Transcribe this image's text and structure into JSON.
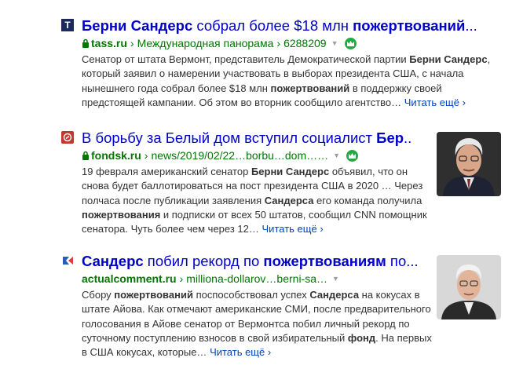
{
  "results": [
    {
      "title_bold1": "Берни Сандерс",
      "title_plain": " собрал более $18 млн ",
      "title_bold2": "пожертвований",
      "title_tail": "...",
      "domain": "tass.ru",
      "path1": "Международная панорама",
      "path2": "6288209",
      "favicon_text": "T",
      "snippet_1": "Сенатор от штата Вермонт, представитель Демократической партии ",
      "snippet_b1": "Берни Сандерс",
      "snippet_2": ", который заявил о намерении участвовать в выборах президента США, с начала нынешнего года собрал более $18 млн ",
      "snippet_b2": "пожертвований",
      "snippet_3": " в поддержку своей предстоящей кампании. Об этом во вторник сообщило агентство…",
      "more": "Читать ещё"
    },
    {
      "title_plain": "В борьбу за Белый дом вступил социалист ",
      "title_bold1": "Бер",
      "title_tail": "...",
      "domain": "fondsk.ru",
      "path1": "news/2019/02/22…borbu…dom……",
      "snippet_1": "19 февраля американский сенатор ",
      "snippet_b1": "Берни Сандерс",
      "snippet_2": " объявил, что он снова будет баллотироваться на пост президента США в 2020 … Через полчаса после публикации заявления ",
      "snippet_b2": "Сандерса",
      "snippet_3": " его команда получила ",
      "snippet_b3": "пожертвования",
      "snippet_4": " и подписки от всех 50 штатов, сообщил CNN помощник сенатора. Чуть более чем через 12…",
      "more": "Читать ещё"
    },
    {
      "title_bold1": "Сандерс",
      "title_plain": " побил рекорд по ",
      "title_bold2": "пожертвованиям",
      "title_tail": " по...",
      "domain": "actualcomment.ru",
      "path1": "milliona-dollarov…berni-sa…",
      "snippet_1": "Сбору ",
      "snippet_b1": "пожертвований",
      "snippet_2": " поспособствовал успех ",
      "snippet_b2": "Сандерса",
      "snippet_3": " на кокусах в штате Айова. Как отмечают американские СМИ, после предварительного голосования в Айове сенатор от Вермонтса побил личный рекорд по суточному поступлению взносов в свой избирательный ",
      "snippet_b3": "фонд",
      "snippet_4": ". На первых в США кокусах, которые…",
      "more": "Читать ещё"
    }
  ],
  "icons": {
    "crown": "crown-icon",
    "lock": "lock-icon",
    "caret": "caret-down-icon",
    "chevron": "chevron-right-icon"
  },
  "colors": {
    "title": "#0000cc",
    "url": "#007700",
    "more": "#0044bb",
    "crown": "#22aa44"
  }
}
